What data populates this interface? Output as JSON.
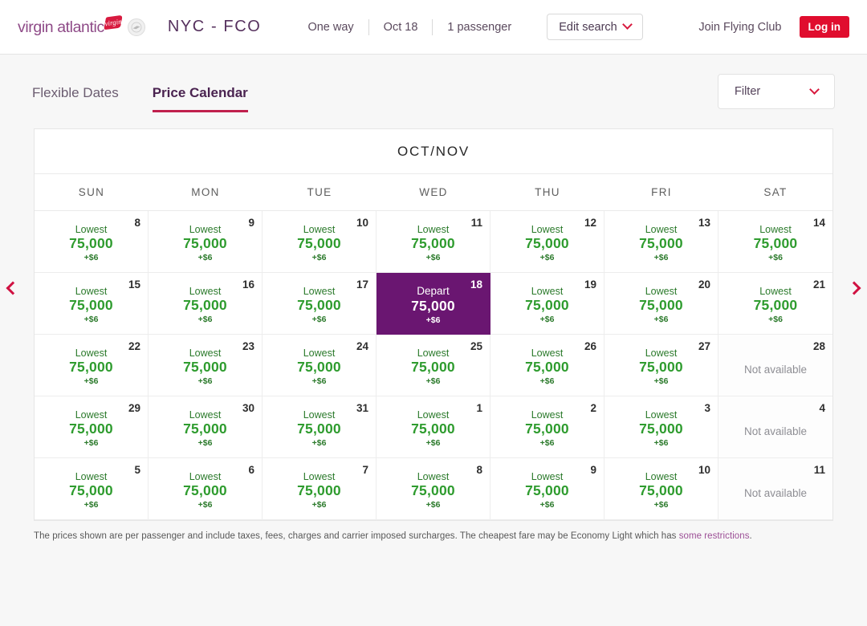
{
  "header": {
    "brand_name": "virgin atlantic",
    "brand_flag_text": "virgin",
    "route": "NYC - FCO",
    "summary": [
      {
        "label": "One way"
      },
      {
        "label": "Oct 18"
      },
      {
        "label": "1 passenger"
      }
    ],
    "edit_search_label": "Edit search",
    "join_label": "Join Flying Club",
    "login_label": "Log in"
  },
  "tabs": [
    {
      "label": "Flexible Dates",
      "active": false
    },
    {
      "label": "Price Calendar",
      "active": true
    }
  ],
  "filter": {
    "label": "Filter"
  },
  "nav": {
    "prev_label": "Previous dates",
    "next_label": "Next dates"
  },
  "calendar": {
    "month_title": "OCT/NOV",
    "day_headers": [
      "SUN",
      "MON",
      "TUE",
      "WED",
      "THU",
      "FRI",
      "SAT"
    ],
    "lowest_label": "Lowest",
    "depart_label": "Depart",
    "unavailable_label": "Not available",
    "cells": [
      {
        "day": "8",
        "state": "available",
        "label": "Lowest",
        "price": "75,000",
        "tax": "+$6"
      },
      {
        "day": "9",
        "state": "available",
        "label": "Lowest",
        "price": "75,000",
        "tax": "+$6"
      },
      {
        "day": "10",
        "state": "available",
        "label": "Lowest",
        "price": "75,000",
        "tax": "+$6"
      },
      {
        "day": "11",
        "state": "available",
        "label": "Lowest",
        "price": "75,000",
        "tax": "+$6"
      },
      {
        "day": "12",
        "state": "available",
        "label": "Lowest",
        "price": "75,000",
        "tax": "+$6"
      },
      {
        "day": "13",
        "state": "available",
        "label": "Lowest",
        "price": "75,000",
        "tax": "+$6"
      },
      {
        "day": "14",
        "state": "available",
        "label": "Lowest",
        "price": "75,000",
        "tax": "+$6"
      },
      {
        "day": "15",
        "state": "available",
        "label": "Lowest",
        "price": "75,000",
        "tax": "+$6"
      },
      {
        "day": "16",
        "state": "available",
        "label": "Lowest",
        "price": "75,000",
        "tax": "+$6"
      },
      {
        "day": "17",
        "state": "available",
        "label": "Lowest",
        "price": "75,000",
        "tax": "+$6"
      },
      {
        "day": "18",
        "state": "selected",
        "label": "Depart",
        "price": "75,000",
        "tax": "+$6"
      },
      {
        "day": "19",
        "state": "available",
        "label": "Lowest",
        "price": "75,000",
        "tax": "+$6"
      },
      {
        "day": "20",
        "state": "available",
        "label": "Lowest",
        "price": "75,000",
        "tax": "+$6"
      },
      {
        "day": "21",
        "state": "available",
        "label": "Lowest",
        "price": "75,000",
        "tax": "+$6"
      },
      {
        "day": "22",
        "state": "available",
        "label": "Lowest",
        "price": "75,000",
        "tax": "+$6"
      },
      {
        "day": "23",
        "state": "available",
        "label": "Lowest",
        "price": "75,000",
        "tax": "+$6"
      },
      {
        "day": "24",
        "state": "available",
        "label": "Lowest",
        "price": "75,000",
        "tax": "+$6"
      },
      {
        "day": "25",
        "state": "available",
        "label": "Lowest",
        "price": "75,000",
        "tax": "+$6"
      },
      {
        "day": "26",
        "state": "available",
        "label": "Lowest",
        "price": "75,000",
        "tax": "+$6"
      },
      {
        "day": "27",
        "state": "available",
        "label": "Lowest",
        "price": "75,000",
        "tax": "+$6"
      },
      {
        "day": "28",
        "state": "unavailable",
        "label": "Not available"
      },
      {
        "day": "29",
        "state": "available",
        "label": "Lowest",
        "price": "75,000",
        "tax": "+$6"
      },
      {
        "day": "30",
        "state": "available",
        "label": "Lowest",
        "price": "75,000",
        "tax": "+$6"
      },
      {
        "day": "31",
        "state": "available",
        "label": "Lowest",
        "price": "75,000",
        "tax": "+$6"
      },
      {
        "day": "1",
        "state": "available",
        "label": "Lowest",
        "price": "75,000",
        "tax": "+$6"
      },
      {
        "day": "2",
        "state": "available",
        "label": "Lowest",
        "price": "75,000",
        "tax": "+$6"
      },
      {
        "day": "3",
        "state": "available",
        "label": "Lowest",
        "price": "75,000",
        "tax": "+$6"
      },
      {
        "day": "4",
        "state": "unavailable",
        "label": "Not available"
      },
      {
        "day": "5",
        "state": "available",
        "label": "Lowest",
        "price": "75,000",
        "tax": "+$6"
      },
      {
        "day": "6",
        "state": "available",
        "label": "Lowest",
        "price": "75,000",
        "tax": "+$6"
      },
      {
        "day": "7",
        "state": "available",
        "label": "Lowest",
        "price": "75,000",
        "tax": "+$6"
      },
      {
        "day": "8",
        "state": "available",
        "label": "Lowest",
        "price": "75,000",
        "tax": "+$6"
      },
      {
        "day": "9",
        "state": "available",
        "label": "Lowest",
        "price": "75,000",
        "tax": "+$6"
      },
      {
        "day": "10",
        "state": "available",
        "label": "Lowest",
        "price": "75,000",
        "tax": "+$6"
      },
      {
        "day": "11",
        "state": "unavailable",
        "label": "Not available"
      }
    ]
  },
  "footer": {
    "text_before": "The prices shown are per passenger and include taxes, fees, charges and carrier imposed surcharges. The cheapest fare may be Economy Light which has ",
    "link_text": "some restrictions",
    "text_after": "."
  },
  "colors": {
    "brand_purple": "#8e4a87",
    "route_purple": "#56315e",
    "accent_red": "#e00d2e",
    "tab_underline": "#c0204d",
    "selected_cell": "#6a1671",
    "price_green": "#2f9c2f",
    "unavailable_grey": "#8e8e94"
  }
}
